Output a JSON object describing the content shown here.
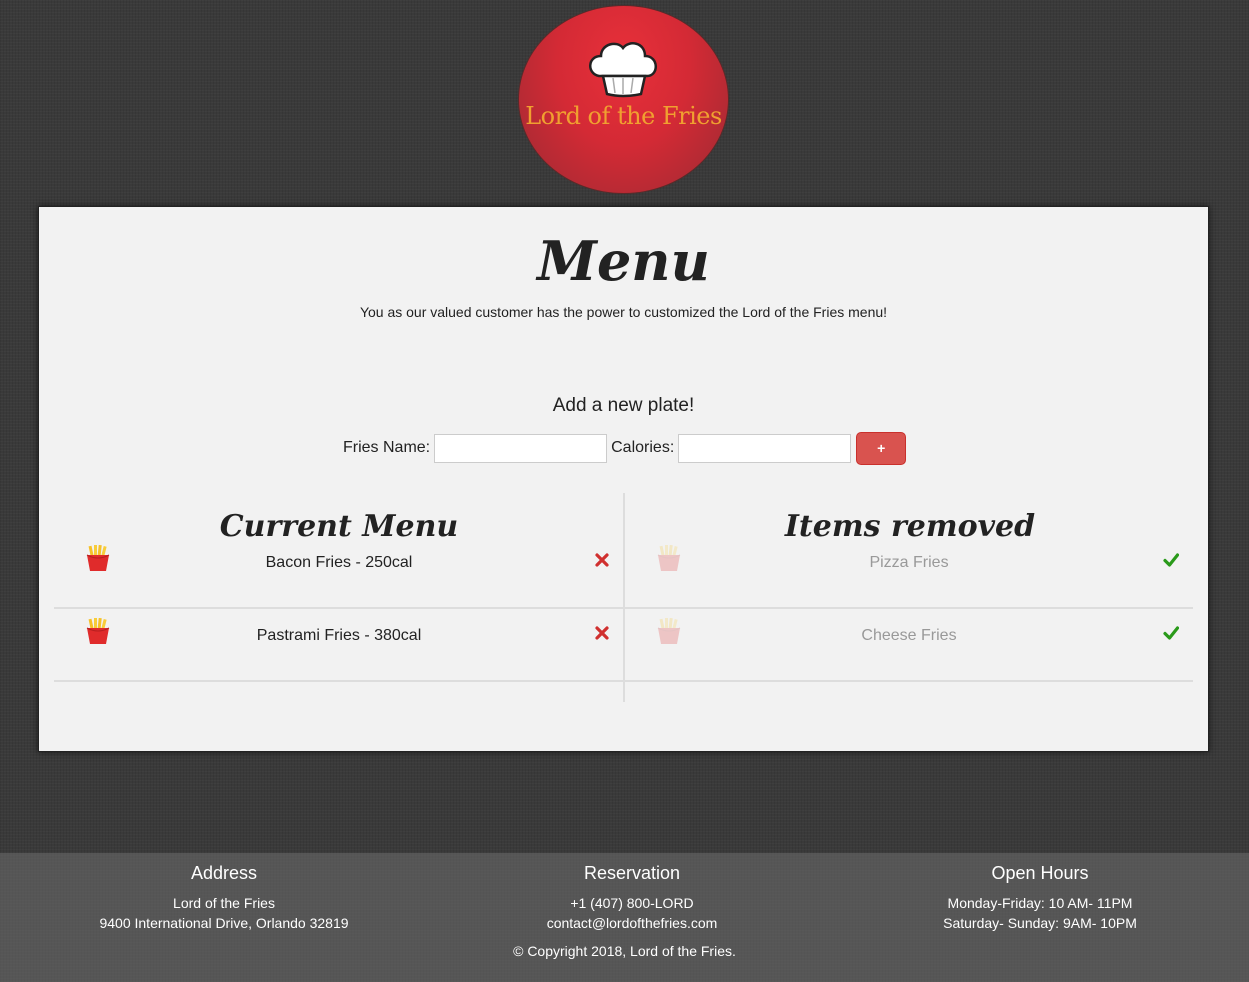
{
  "brand": {
    "logo_text": "Lord of the Fries"
  },
  "menu": {
    "title": "Menu",
    "subtitle": "You as our valued customer has the power to customized the Lord of the Fries menu!"
  },
  "add_form": {
    "heading": "Add a new plate!",
    "name_label": "Fries Name:",
    "name_value": "",
    "calories_label": "Calories:",
    "calories_value": "",
    "add_button_label": "+"
  },
  "current_menu": {
    "title": "Current Menu",
    "items": [
      {
        "label": "Bacon Fries - 250cal",
        "icon": "fries-icon",
        "action_icon": "remove-x-icon"
      },
      {
        "label": "Pastrami Fries - 380cal",
        "icon": "fries-icon",
        "action_icon": "remove-x-icon"
      }
    ]
  },
  "removed_items": {
    "title": "Items removed",
    "items": [
      {
        "label": "Pizza Fries",
        "icon": "fries-icon",
        "action_icon": "restore-check-icon"
      },
      {
        "label": "Cheese Fries",
        "icon": "fries-icon",
        "action_icon": "restore-check-icon"
      }
    ]
  },
  "footer": {
    "address": {
      "heading": "Address",
      "line1": "Lord of the Fries",
      "line2": "9400 International Drive, Orlando 32819"
    },
    "reservation": {
      "heading": "Reservation",
      "line1": "+1 (407) 800-LORD",
      "line2": "contact@lordofthefries.com"
    },
    "hours": {
      "heading": "Open Hours",
      "line1": "Monday-Friday: 10 AM- 11PM",
      "line2": "Saturday- Sunday: 9AM- 10PM"
    },
    "copyright": "© Copyright 2018, Lord of the Fries."
  },
  "colors": {
    "accent_red": "#d9534f",
    "remove_red": "#d0302f",
    "check_green": "#2a9a1a",
    "logo_text": "#f0a030"
  }
}
